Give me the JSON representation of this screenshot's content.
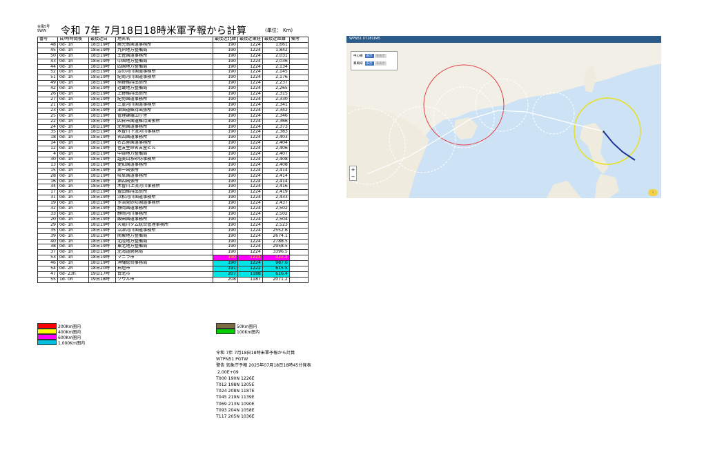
{
  "header": {
    "doc_code": "台風5号 9WW",
    "title": "令和 7年 7月18日18時米軍予報から計算",
    "unit": "(単位： Km)"
  },
  "table": {
    "columns": [
      "番号",
      "日/時時間後",
      "最接近日",
      "地名名",
      "最接近北緯",
      "最接近東経",
      "最接近距離",
      "備考"
    ],
    "rows": [
      [
        "48",
        "0d- 1h",
        "18日19時",
        "鹿児島国道事務所",
        "190",
        "1224",
        "1,661",
        ""
      ],
      [
        "45",
        "0d- 1h",
        "18日19時",
        "九州地方整備局",
        "190",
        "1224",
        "1,842",
        ""
      ],
      [
        "50",
        "0d- 1h",
        "18日19時",
        "土佐国道事務所",
        "190",
        "1224",
        "2,031",
        ""
      ],
      [
        "43",
        "0d- 1h",
        "18日19時",
        "中国地方整備局",
        "190",
        "1224",
        "2,036",
        ""
      ],
      [
        "44",
        "0d- 1h",
        "18日19時",
        "四国地方整備局",
        "190",
        "1224",
        "2,134",
        ""
      ],
      [
        "52",
        "0d- 1h",
        "18日19時",
        "淀の河川国道事務所",
        "190",
        "1224",
        "2,145",
        ""
      ],
      [
        "51",
        "0d- 1h",
        "18日19時",
        "紀南河川国道事務所",
        "190",
        "1224",
        "2,176",
        ""
      ],
      [
        "49",
        "0d- 1h",
        "18日19時",
        "熊野維持出張所",
        "190",
        "1224",
        "2,237",
        ""
      ],
      [
        "42",
        "0d- 1h",
        "18日19時",
        "近畿地方整備局",
        "190",
        "1224",
        "2,265",
        ""
      ],
      [
        "26",
        "0d- 1h",
        "18日19時",
        "上野維持出張所",
        "190",
        "1224",
        "2,315",
        ""
      ],
      [
        "27",
        "0d- 1h",
        "18日19時",
        "紀勢国道事務所",
        "190",
        "1224",
        "2,330",
        ""
      ],
      [
        "21",
        "0d- 1h",
        "18日19時",
        "三重河川国道事務所",
        "190",
        "1224",
        "2,341",
        ""
      ],
      [
        "23",
        "0d- 1h",
        "18日19時",
        "津国道維持出張所",
        "190",
        "1224",
        "2,342",
        ""
      ],
      [
        "25",
        "0d- 1h",
        "18日19時",
        "管理課亀山庁舎",
        "190",
        "1224",
        "2,346",
        ""
      ],
      [
        "22",
        "0d- 1h",
        "18日19時",
        "四日市国道維持出張所",
        "190",
        "1224",
        "2,366",
        ""
      ],
      [
        "24",
        "0d- 1h",
        "18日19時",
        "北勢国道事務所",
        "190",
        "1224",
        "2,373",
        ""
      ],
      [
        "35",
        "0d- 1h",
        "18日19時",
        "木曽川下流河川事務所",
        "190",
        "1224",
        "2,383",
        ""
      ],
      [
        "18",
        "0d- 1h",
        "18日19時",
        "名四国道事務所",
        "190",
        "1224",
        "2,403",
        ""
      ],
      [
        "14",
        "0d- 1h",
        "18日19時",
        "名古屋国道事務所",
        "190",
        "1224",
        "2,404",
        ""
      ],
      [
        "12",
        "0d- 1h",
        "18日19時",
        "住友生命名古屋ビル",
        "190",
        "1224",
        "2,406",
        ""
      ],
      [
        "4",
        "0d- 1h",
        "18日19時",
        "中部地方整備局",
        "190",
        "1224",
        "2,407",
        ""
      ],
      [
        "30",
        "0d- 1h",
        "18日19時",
        "越美山系砂防事務所",
        "190",
        "1224",
        "2,408",
        ""
      ],
      [
        "13",
        "0d- 1h",
        "18日19時",
        "愛知国道事務所",
        "190",
        "1224",
        "2,408",
        ""
      ],
      [
        "15",
        "0d- 1h",
        "18日19時",
        "第一出張所",
        "190",
        "1224",
        "2,414",
        ""
      ],
      [
        "28",
        "0d- 1h",
        "18日19時",
        "岐阜国道事務所",
        "190",
        "1224",
        "2,414",
        ""
      ],
      [
        "16",
        "0d- 1h",
        "18日19時",
        "第四出張所",
        "190",
        "1224",
        "2,414",
        ""
      ],
      [
        "34",
        "0d- 1h",
        "18日19時",
        "木曽川上流河川事務所",
        "190",
        "1224",
        "2,416",
        ""
      ],
      [
        "17",
        "0d- 1h",
        "18日19時",
        "豊田維持出張所",
        "190",
        "1224",
        "2,419",
        ""
      ],
      [
        "31",
        "0d- 1h",
        "18日19時",
        "浜松河川国道事務所",
        "190",
        "1224",
        "2,433",
        ""
      ],
      [
        "19",
        "0d- 1h",
        "18日19時",
        "多治見砂防国道事務所",
        "190",
        "1224",
        "2,437",
        ""
      ],
      [
        "32",
        "0d- 1h",
        "18日19時",
        "静岡国道事務所",
        "190",
        "1224",
        "2,502",
        ""
      ],
      [
        "33",
        "0d- 1h",
        "18日19時",
        "静岡河川事務所",
        "190",
        "1224",
        "2,502",
        ""
      ],
      [
        "20",
        "0d- 1h",
        "18日19時",
        "飯田国道事務所",
        "190",
        "1224",
        "2,504",
        ""
      ],
      [
        "29",
        "0d- 1h",
        "18日19時",
        "天竜川ダム統合管理事務所",
        "190",
        "1224",
        "2,523",
        ""
      ],
      [
        "35",
        "0d- 1h",
        "18日19時",
        "沼津河川国道事務所",
        "190",
        "1224",
        "2552.6",
        ""
      ],
      [
        "39",
        "0d- 1h",
        "18日19時",
        "関東地方整備局",
        "190",
        "1224",
        "2674.1",
        ""
      ],
      [
        "40",
        "0d- 1h",
        "18日19時",
        "北陸地方整備局",
        "190",
        "1224",
        "2788.5",
        ""
      ],
      [
        "38",
        "0d- 1h",
        "18日19時",
        "東北地方整備局",
        "190",
        "1224",
        "2958.5",
        ""
      ],
      [
        "37",
        "0d- 1h",
        "18日19時",
        "北海道開発局",
        "190",
        "1224",
        "3396.5",
        ""
      ],
      [
        "53",
        "0d- 1h",
        "18日19時",
        "マニラ市",
        "190",
        "1224",
        "422.4",
        ""
      ],
      [
        "46",
        "0d- 1h",
        "18日19時",
        "沖縄総合事務局",
        "190",
        "1224",
        "987.6",
        ""
      ],
      [
        "54",
        "0d- 2h",
        "18日20時",
        "石垣市",
        "191",
        "1222",
        "615.5",
        ""
      ],
      [
        "47",
        "0d- 23h",
        "19日17時",
        "台北市",
        "207",
        "1188",
        "616.4",
        ""
      ],
      [
        "55",
        "1d- 0h",
        "19日18時",
        "ソウル市",
        "208",
        "1187",
        "2071.2",
        ""
      ]
    ],
    "highlight_rows": {
      "39": "hl-600",
      "40": "hl-1000",
      "41": "hl-1000",
      "42": "hl-1000"
    }
  },
  "legend_left": [
    {
      "label": "200Km圏内",
      "color": "#ff0000"
    },
    {
      "label": "400Km圏内",
      "color": "#ffff00"
    },
    {
      "label": "600Km圏内",
      "color": "#ff00ff"
    },
    {
      "label": "1,000Km圏内",
      "color": "#00c0e0"
    }
  ],
  "legend_right": [
    {
      "label": "50Km圏内",
      "color": "#7a6b45"
    },
    {
      "label": "100Km圏内",
      "color": "#00cc00"
    }
  ],
  "notes": [
    "令和 7年 7月18日18時米軍予報から計算",
    "WTPN51 PGTW",
    "警告 気象庁予報 2025年07月18日18時45分発表",
    " 2.00E+09",
    "T000 190N 1226E",
    "T012 198N 1205E",
    "T024 208N 1187E",
    "T045 219N 1139E",
    "T069 213N 1090E",
    "T093 204N 1058E",
    "T117 205N 1036E"
  ],
  "map": {
    "bar_text": "WPN51 07181845",
    "center_line_label": "中心線",
    "storm_circle_label": "暴風域",
    "show_label": "表示",
    "hide_label": "非表示",
    "zoom_in": "+",
    "zoom_out": "−",
    "badge": "i"
  }
}
